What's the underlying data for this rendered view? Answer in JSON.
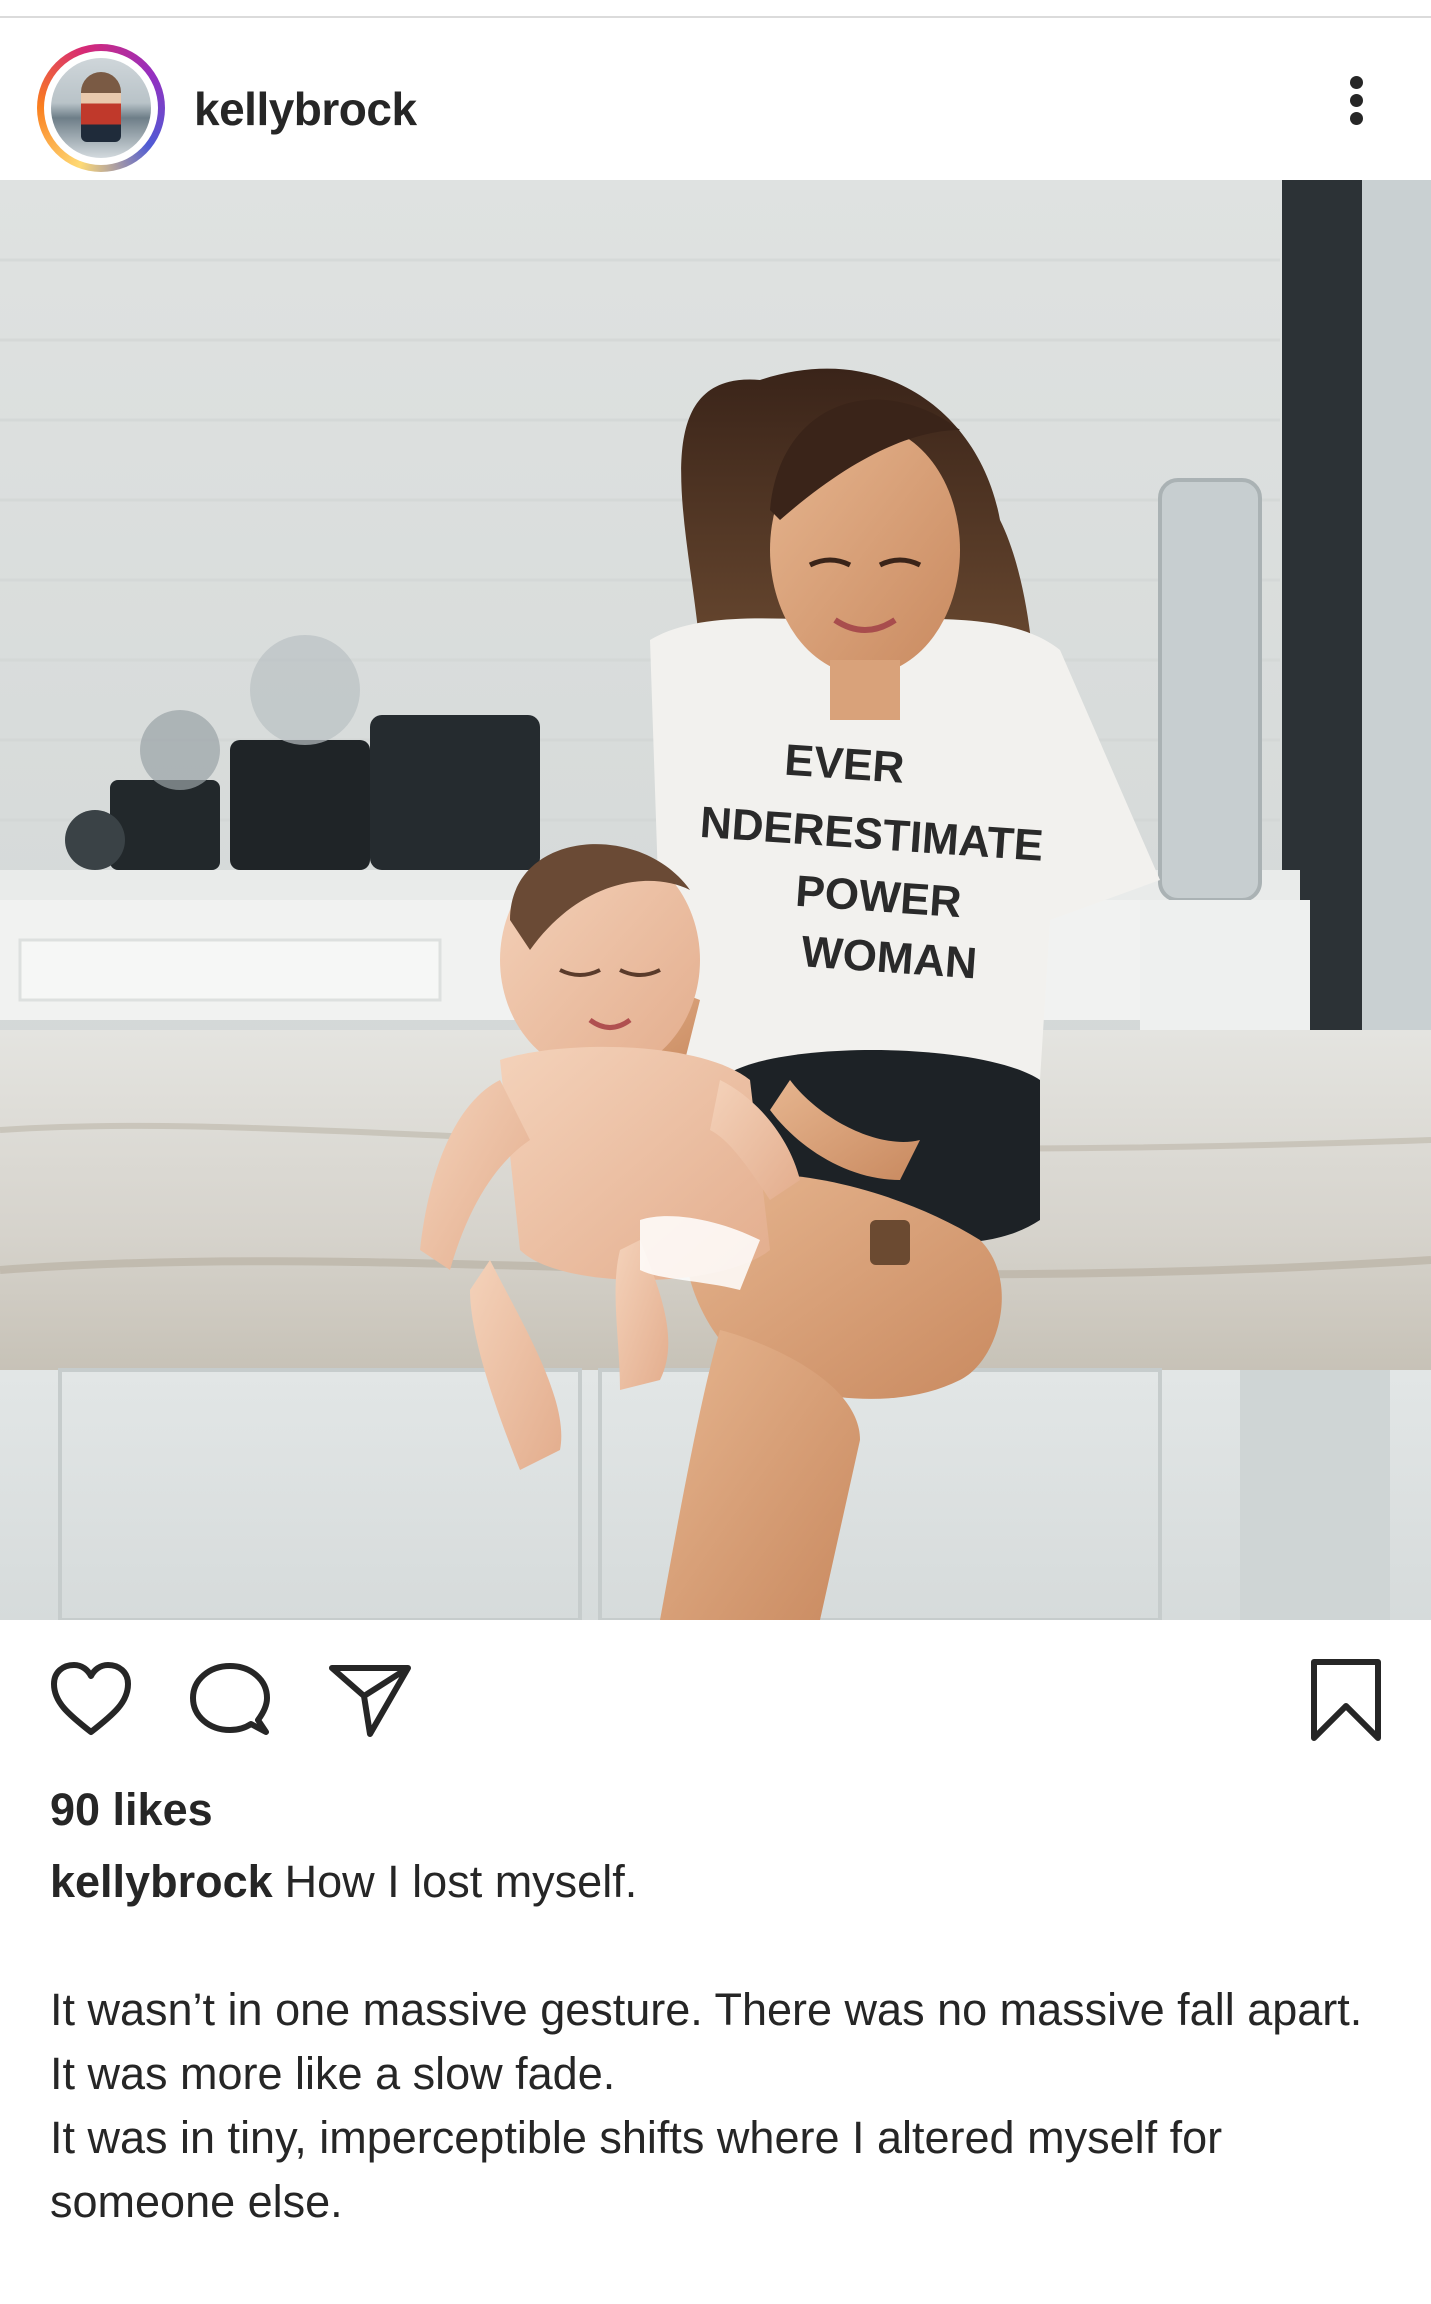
{
  "post": {
    "username": "kellybrock",
    "avatar_icon": "profile-photo-story-ring",
    "more_icon": "more-options-vertical-icon",
    "image_description_icon": "post-photo",
    "actions": {
      "like_icon": "heart-outline-icon",
      "comment_icon": "comment-bubble-icon",
      "share_icon": "paper-plane-share-icon",
      "save_icon": "bookmark-outline-icon"
    },
    "likes_text": "90 likes",
    "caption": {
      "username": "kellybrock",
      "first_line": "How I lost myself.",
      "lines": [
        "It wasn’t in one massive gesture. There was no massive fall apart.",
        "It was more like a slow fade.",
        "It was in tiny, imperceptible  shifts where I altered myself for someone else."
      ]
    },
    "photo_shirt_text": [
      "EVER",
      "NDERESTIMATE",
      "POWER",
      "WOMAN"
    ]
  },
  "colors": {
    "text": "#262626",
    "divider": "#dbdbdb",
    "story_ring": [
      "#feda75",
      "#fa7e1e",
      "#d62976",
      "#962fbf",
      "#4f5bd5"
    ]
  }
}
